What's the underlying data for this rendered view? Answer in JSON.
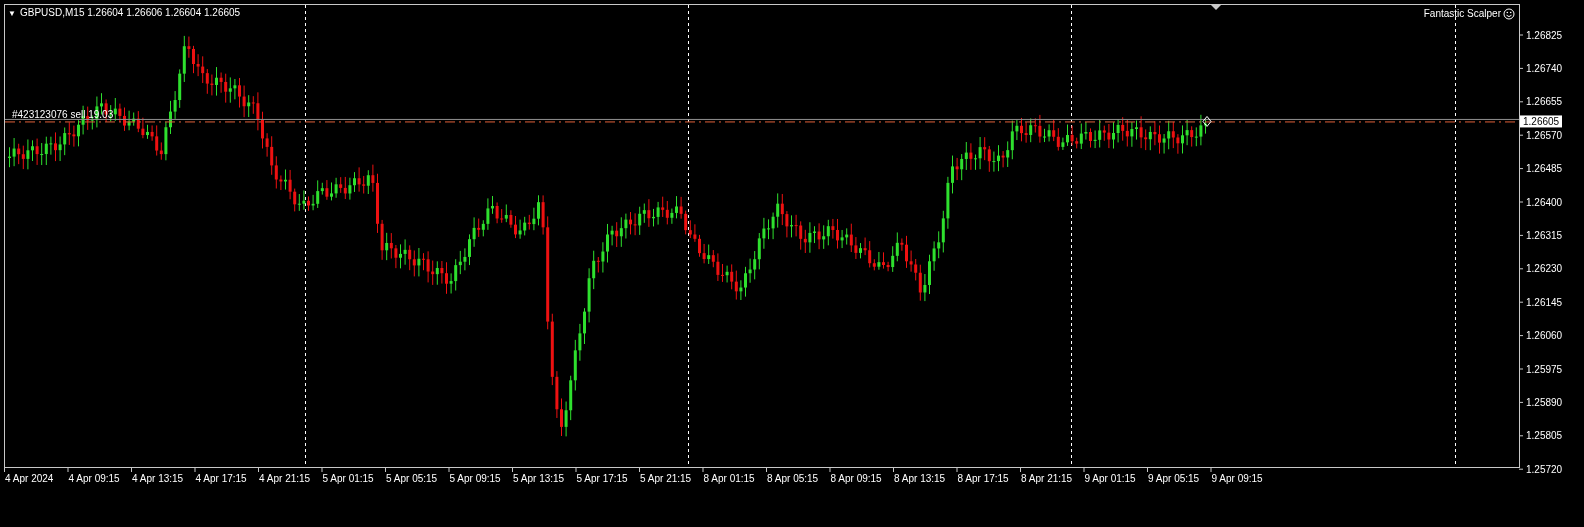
{
  "chart": {
    "menu_arrow": "▼",
    "symbol_line": "GBPUSD,M15  1.26604 1.26606 1.26604 1.26605",
    "indicator": "Fantastic Scalper",
    "order_label": "#423123076 sell 19.03",
    "current_price": "1.26605",
    "price_ticks": [
      "1.26825",
      "1.26740",
      "1.26655",
      "1.26570",
      "1.26485",
      "1.26400",
      "1.26315",
      "1.26230",
      "1.26145",
      "1.26060",
      "1.25975",
      "1.25890",
      "1.25805",
      "1.25720"
    ],
    "time_ticks": [
      "4 Apr 2024",
      "4 Apr 09:15",
      "4 Apr 13:15",
      "4 Apr 17:15",
      "4 Apr 21:15",
      "5 Apr 01:15",
      "5 Apr 05:15",
      "5 Apr 09:15",
      "5 Apr 13:15",
      "5 Apr 17:15",
      "5 Apr 21:15",
      "8 Apr 01:15",
      "8 Apr 05:15",
      "8 Apr 09:15",
      "8 Apr 13:15",
      "8 Apr 17:15",
      "8 Apr 21:15",
      "9 Apr 01:15",
      "9 Apr 05:15",
      "9 Apr 09:15"
    ]
  }
}
